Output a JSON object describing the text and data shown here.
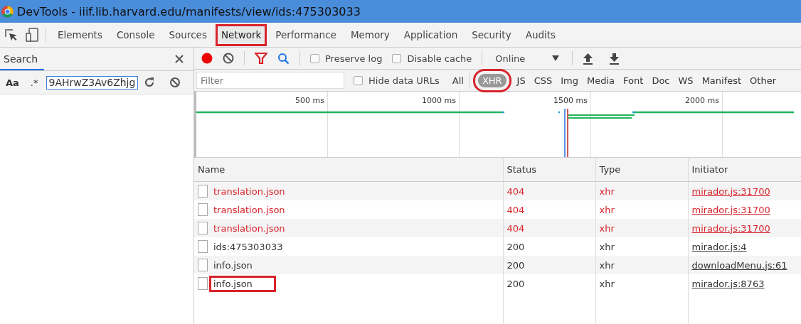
{
  "window": {
    "title": "DevTools - iiif.lib.harvard.edu/manifests/view/ids:475303033"
  },
  "tabs": [
    {
      "label": "Elements",
      "selected": false,
      "highlighted": false
    },
    {
      "label": "Console",
      "selected": false,
      "highlighted": false
    },
    {
      "label": "Sources",
      "selected": false,
      "highlighted": false
    },
    {
      "label": "Network",
      "selected": true,
      "highlighted": true
    },
    {
      "label": "Performance",
      "selected": false,
      "highlighted": false
    },
    {
      "label": "Memory",
      "selected": false,
      "highlighted": false
    },
    {
      "label": "Application",
      "selected": false,
      "highlighted": false
    },
    {
      "label": "Security",
      "selected": false,
      "highlighted": false
    },
    {
      "label": "Audits",
      "selected": false,
      "highlighted": false
    }
  ],
  "search_panel": {
    "title": "Search",
    "match_case": "Aa",
    "regex": ".*",
    "query": "9AHrwZ3Av6Zhjg"
  },
  "toolbar": {
    "recording": true,
    "preserve_log": {
      "label": "Preserve log",
      "checked": false
    },
    "disable_cache": {
      "label": "Disable cache",
      "checked": false
    },
    "throttling": "Online"
  },
  "filter_bar": {
    "placeholder": "Filter",
    "hide_data_urls": {
      "label": "Hide data URLs",
      "checked": false
    },
    "types": [
      {
        "label": "All",
        "selected": false,
        "highlighted": false
      },
      {
        "label": "XHR",
        "selected": true,
        "highlighted": true
      },
      {
        "label": "JS",
        "selected": false,
        "highlighted": false
      },
      {
        "label": "CSS",
        "selected": false,
        "highlighted": false
      },
      {
        "label": "Img",
        "selected": false,
        "highlighted": false
      },
      {
        "label": "Media",
        "selected": false,
        "highlighted": false
      },
      {
        "label": "Font",
        "selected": false,
        "highlighted": false
      },
      {
        "label": "Doc",
        "selected": false,
        "highlighted": false
      },
      {
        "label": "WS",
        "selected": false,
        "highlighted": false
      },
      {
        "label": "Manifest",
        "selected": false,
        "highlighted": false
      },
      {
        "label": "Other",
        "selected": false,
        "highlighted": false
      }
    ]
  },
  "overview": {
    "ticks": [
      "500 ms",
      "1000 ms",
      "1500 ms",
      "2000 ms"
    ]
  },
  "table": {
    "columns": [
      "Name",
      "Status",
      "Type",
      "Initiator"
    ],
    "rows": [
      {
        "name": "translation.json",
        "status": "404",
        "type": "xhr",
        "initiator": "mirador.js:31700",
        "failed": true,
        "highlighted": false
      },
      {
        "name": "translation.json",
        "status": "404",
        "type": "xhr",
        "initiator": "mirador.js:31700",
        "failed": true,
        "highlighted": false
      },
      {
        "name": "translation.json",
        "status": "404",
        "type": "xhr",
        "initiator": "mirador.js:31700",
        "failed": true,
        "highlighted": false
      },
      {
        "name": "ids:475303033",
        "status": "200",
        "type": "xhr",
        "initiator": "mirador.js:4",
        "failed": false,
        "highlighted": false
      },
      {
        "name": "info.json",
        "status": "200",
        "type": "xhr",
        "initiator": "downloadMenu.js:61",
        "failed": false,
        "highlighted": false
      },
      {
        "name": "info.json",
        "status": "200",
        "type": "xhr",
        "initiator": "mirador.js:8763",
        "failed": false,
        "highlighted": true
      }
    ]
  }
}
